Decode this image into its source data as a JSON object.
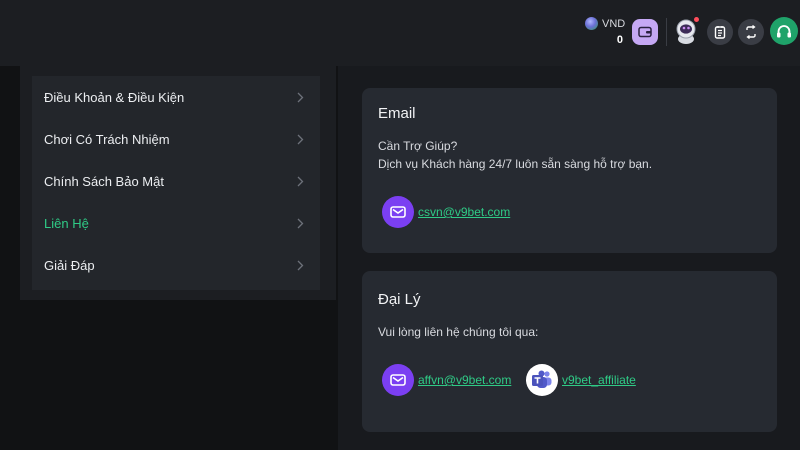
{
  "header": {
    "currency_code": "VND",
    "balance": "0",
    "icons": [
      "coin-icon",
      "wallet-icon",
      "avatar-icon",
      "notepad-icon",
      "transfer-icon",
      "headset-icon"
    ],
    "colors": {
      "support": "#1fa36a",
      "wallet": "#c5a8f4",
      "notification": "#ff4d5b"
    }
  },
  "sidebar": {
    "items": [
      {
        "label": "Điều Khoản & Điều Kiện",
        "active": false
      },
      {
        "label": "Chơi Có Trách Nhiệm",
        "active": false
      },
      {
        "label": "Chính Sách Bảo Mật",
        "active": false
      },
      {
        "label": "Liên Hệ",
        "active": true
      },
      {
        "label": "Giải Đáp",
        "active": false
      }
    ],
    "active_color": "#2fcb86"
  },
  "email_card": {
    "title": "Email",
    "help_title": "Cần Trợ Giúp?",
    "help_text": "Dịch vụ Khách hàng 24/7 luôn sẵn sàng hỗ trợ bạn.",
    "email": "csvn@v9bet.com"
  },
  "agent_card": {
    "title": "Đại Lý",
    "text": "Vui lòng liên hệ chúng tôi qua:",
    "email": "affvn@v9bet.com",
    "teams": "v9bet_affiliate"
  }
}
